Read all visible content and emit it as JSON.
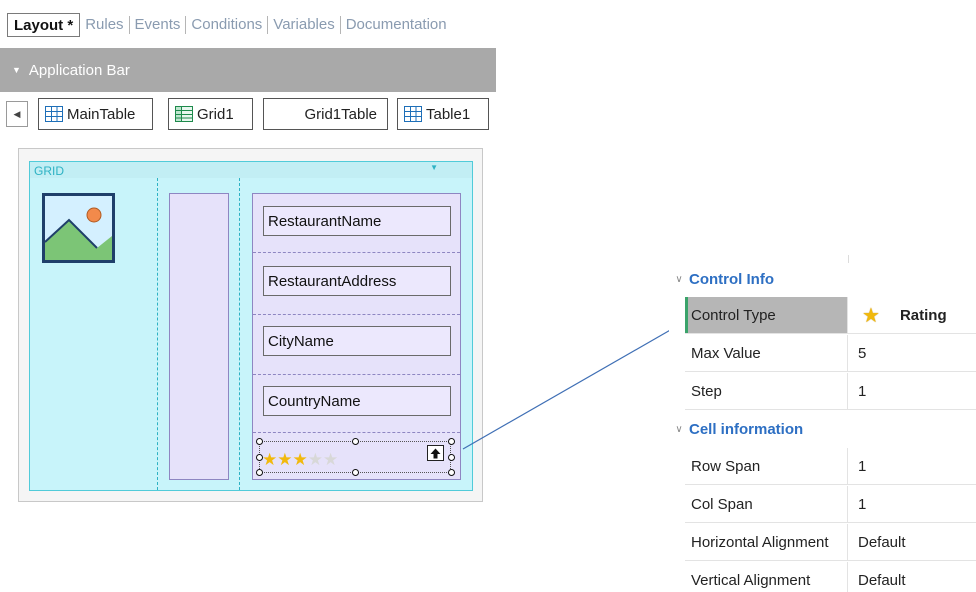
{
  "tabs": [
    {
      "label": "Layout *",
      "active": true
    },
    {
      "label": "Rules",
      "active": false
    },
    {
      "label": "Events",
      "active": false
    },
    {
      "label": "Conditions",
      "active": false
    },
    {
      "label": "Variables",
      "active": false
    },
    {
      "label": "Documentation",
      "active": false
    }
  ],
  "app_bar": {
    "label": "Application Bar",
    "icon": "caret-down-icon"
  },
  "breadcrumb": {
    "back_icon": "caret-left-icon",
    "items": [
      {
        "label": "MainTable",
        "icon": "table-icon"
      },
      {
        "label": "Grid1",
        "icon": "grid-icon"
      },
      {
        "label": "Grid1Table",
        "icon": ""
      },
      {
        "label": "Table1",
        "icon": "table-icon"
      }
    ]
  },
  "grid": {
    "label": "GRID",
    "image_icon": "image-placeholder-icon",
    "fields": [
      "RestaurantName",
      "RestaurantAddress",
      "CityName",
      "CountryName"
    ],
    "rating": {
      "value": 3,
      "max": 5,
      "icon": "star-icon"
    },
    "up_icon": "arrow-up-icon"
  },
  "properties": {
    "sections": [
      {
        "title": "Control Info",
        "rows": [
          {
            "name": "Control Type",
            "value": "Rating",
            "icon": "star-icon",
            "selected": true
          },
          {
            "name": "Max Value",
            "value": "5"
          },
          {
            "name": "Step",
            "value": "1"
          }
        ]
      },
      {
        "title": "Cell information",
        "rows": [
          {
            "name": "Row Span",
            "value": "1"
          },
          {
            "name": "Col Span",
            "value": "1"
          },
          {
            "name": "Horizontal Alignment",
            "value": "Default"
          },
          {
            "name": "Vertical Alignment",
            "value": "Default"
          }
        ]
      }
    ]
  },
  "colors": {
    "grid_bg": "#c8f4fa",
    "grid_border": "#51cbd9",
    "table_bg": "#e6e2fa",
    "section_title": "#2d6fc3",
    "selected_row": "#b6b6b6",
    "star": "#f1b90d",
    "connector": "#3f6fb5"
  }
}
